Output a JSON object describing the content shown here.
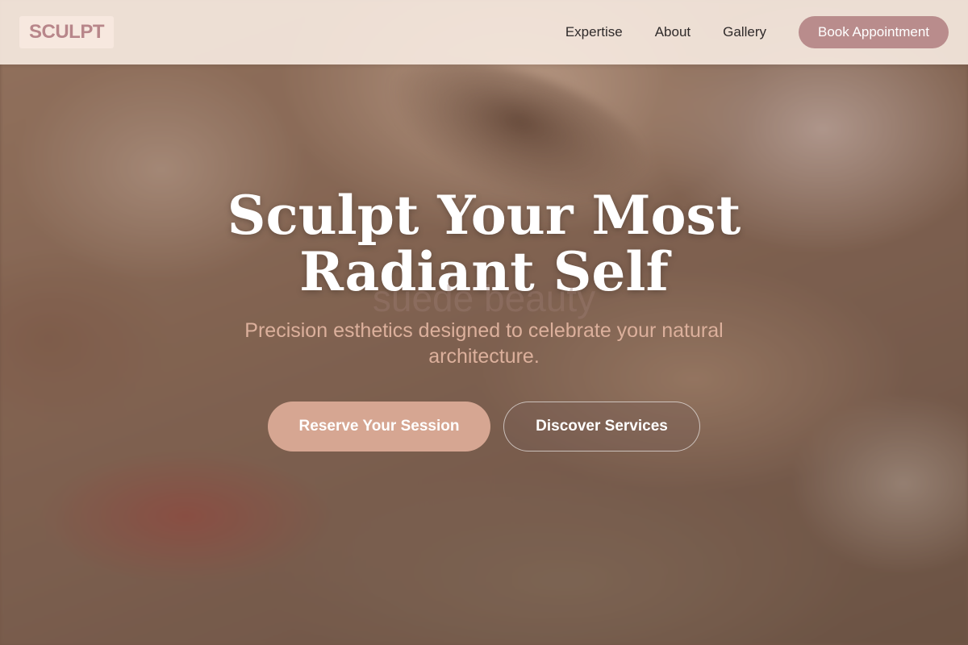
{
  "header": {
    "logo": "SCULPT",
    "nav": [
      {
        "label": "Expertise"
      },
      {
        "label": "About"
      },
      {
        "label": "Gallery"
      }
    ],
    "cta_label": "Book Appointment"
  },
  "hero": {
    "background_image": "blurred close-up of eye with lashes and lips",
    "title": "Sculpt Your Most Radiant Self",
    "watermark": "suede beauty",
    "subtitle": "Precision esthetics designed to celebrate your natural architecture.",
    "primary_button": "Reserve Your Session",
    "secondary_button": "Discover Services"
  },
  "colors": {
    "logo_text": "#b8868a",
    "nav_cta_bg": "#b98c8c",
    "primary_button_bg": "#d6a692",
    "subtitle": "#dcb09c"
  }
}
